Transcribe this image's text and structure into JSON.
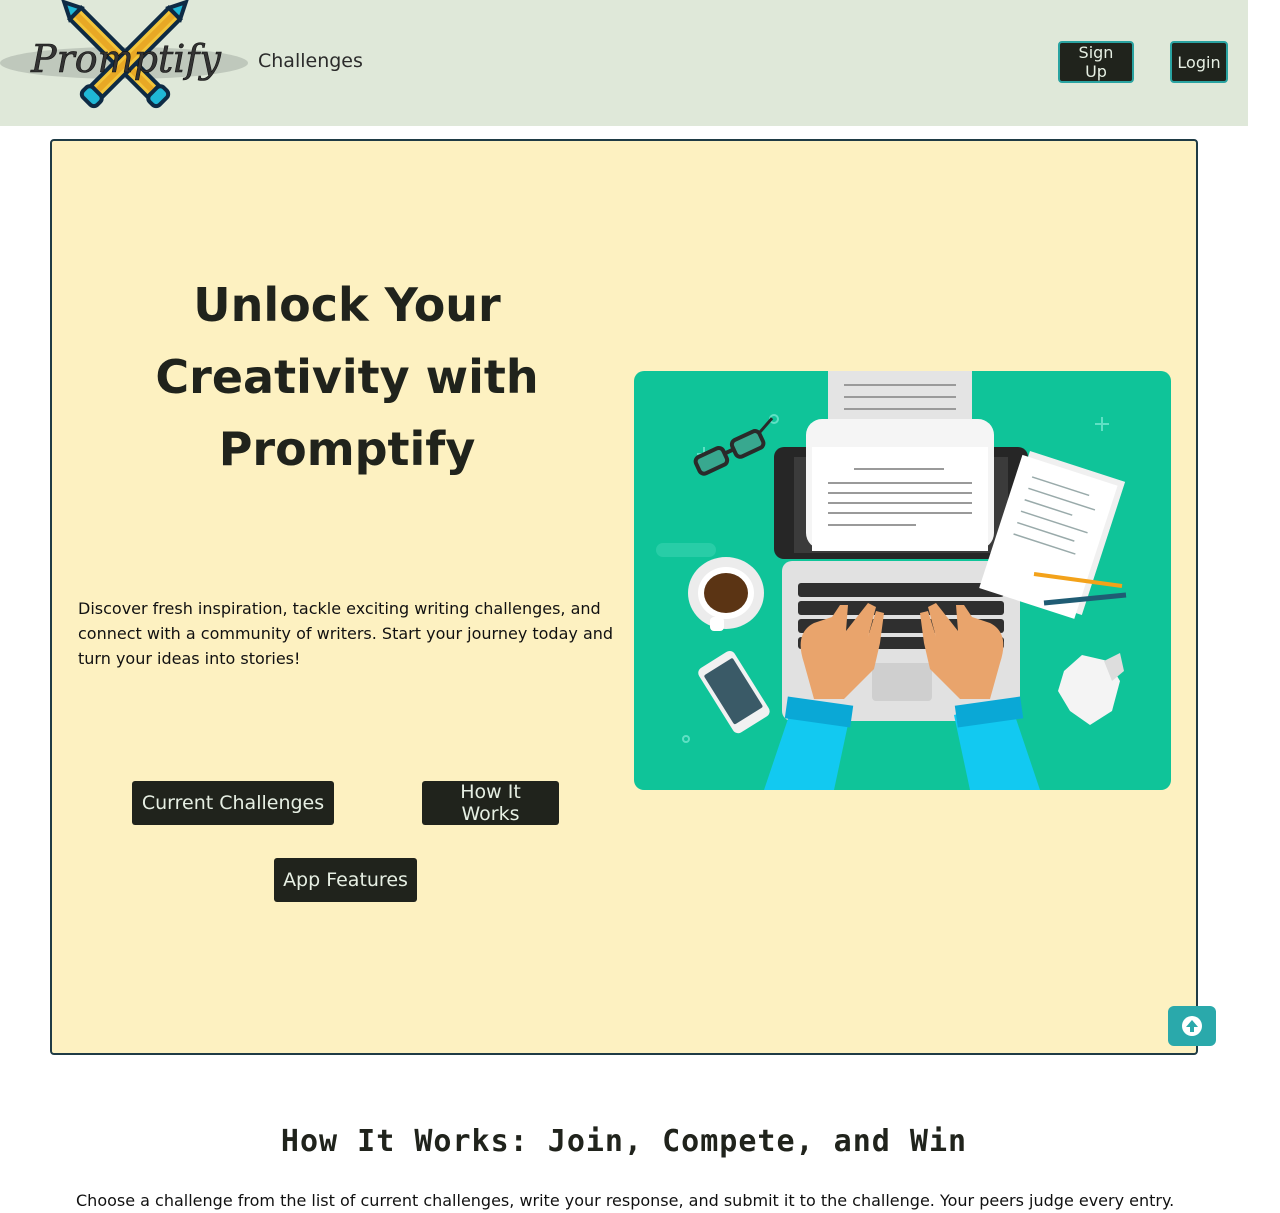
{
  "brand": {
    "logo_text": "Promptify"
  },
  "nav": {
    "challenges_label": "Challenges",
    "signup_label": "Sign Up",
    "login_label": "Login"
  },
  "hero": {
    "title": "Unlock Your Creativity with Promptify",
    "description": "Discover fresh inspiration, tackle exciting writing challenges, and connect with a community of writers. Start your journey today and turn your ideas into stories!",
    "buttons": {
      "current_challenges": "Current Challenges",
      "how_it_works": "How It Works",
      "app_features": "App Features"
    }
  },
  "how_it_works": {
    "title": "How It Works: Join, Compete, and Win",
    "intro": "Choose a challenge from the list of current challenges, write your response, and submit it to the challenge. Your peers judge every entry."
  },
  "colors": {
    "navbar_bg": "#dfe8d9",
    "hero_bg": "#fdf1c1",
    "button_bg": "#20231c",
    "accent_teal": "#2aa9ab",
    "illustration_bg": "#0fc499"
  }
}
